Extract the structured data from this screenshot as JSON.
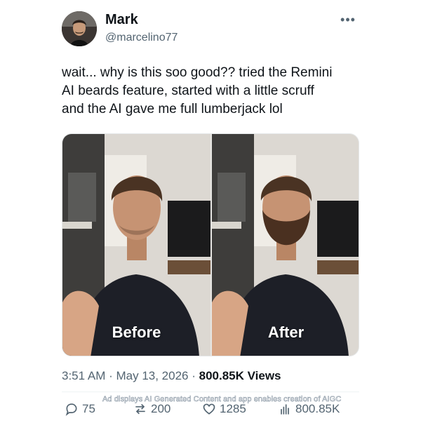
{
  "author": {
    "name": "Mark",
    "handle": "@marcelino77"
  },
  "tweet": {
    "text": "wait... why is this soo good?? tried the Remini\nAI beards feature, started with a little scruff\nand the AI gave me full lumberjack lol",
    "time": "3:51 AM",
    "separator": " · ",
    "date": "May 13, 2026",
    "views": "800.85K Views"
  },
  "media": {
    "before_label": "Before",
    "after_label": "After"
  },
  "actions": {
    "replies": "75",
    "retweets": "200",
    "likes": "1285",
    "views": "800.85K"
  },
  "ad_disclosure": "Ad displays AI Generated Content and app enables creation of AIGC",
  "icons": {
    "more": "more-options-icon",
    "reply": "reply-icon",
    "retweet": "retweet-icon",
    "like": "heart-icon",
    "views": "views-chart-icon"
  },
  "colors": {
    "text": "#0f1419",
    "secondary": "#536471",
    "divider": "#eff3f4"
  }
}
